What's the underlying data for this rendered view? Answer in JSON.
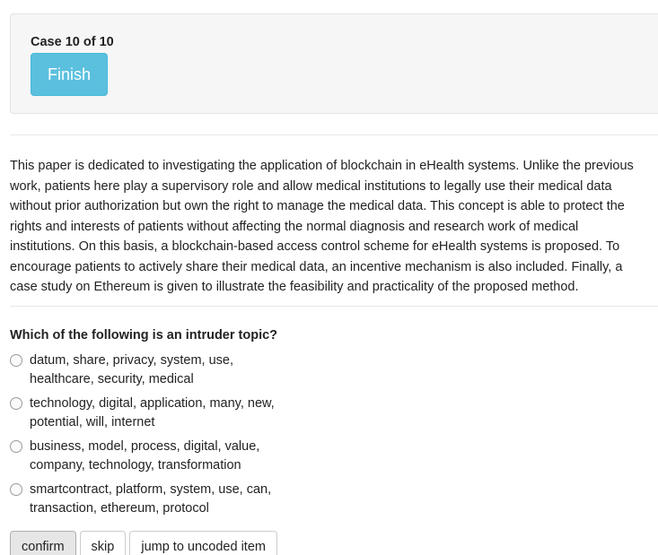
{
  "case_panel": {
    "label": "Case 10 of 10",
    "finish_label": "Finish",
    "finish_color": "#5bc0de"
  },
  "abstract_lines": [
    "This paper is dedicated to investigating the application of blockchain in eHealth systems. Unlike the previous",
    "work, patients here play a supervisory role and allow medical institutions to legally use their medical data",
    "without prior authorization but own the right to manage the medical data. This concept is able to protect the",
    "rights and interests of patients without affecting the normal diagnosis and research work of medical",
    "institutions. On this basis, a blockchain-based access control scheme for eHealth systems is proposed. To",
    "encourage patients to actively share their medical data, an incentive mechanism is also included. Finally, a",
    "case study on Ethereum is given to illustrate the feasibility and practicality of the proposed method."
  ],
  "question": "Which of the following is an intruder topic?",
  "options": [
    {
      "line1": "datum, share, privacy, system, use,",
      "line2": "healthcare, security, medical"
    },
    {
      "line1": "technology, digital, application, many, new,",
      "line2": "potential, will, internet"
    },
    {
      "line1": "business, model, process, digital, value,",
      "line2": "company, technology, transformation"
    },
    {
      "line1": "smartcontract, platform, system, use, can,",
      "line2": "transaction, ethereum, protocol"
    }
  ],
  "actions": {
    "confirm_label": "confirm",
    "skip_label": "skip",
    "jump_label": "jump to uncoded item"
  }
}
